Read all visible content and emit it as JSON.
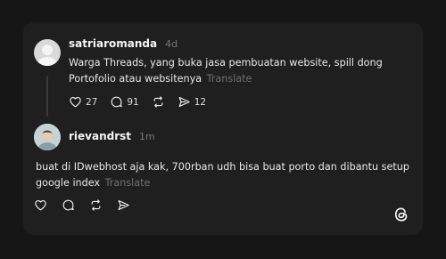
{
  "posts": [
    {
      "username": "satriaromanda",
      "time": "4d",
      "text": "Warga Threads, yang buka jasa pembuatan website, spill dong Portofolio atau websitenya",
      "translate": "Translate",
      "likes": "27",
      "replies": "91",
      "shares": "12"
    },
    {
      "username": "rievandrst",
      "time": "1m",
      "text": "buat di IDwebhost aja kak, 700rban udh bisa buat porto dan dibantu setup google index",
      "translate": "Translate"
    }
  ],
  "icons": {
    "like": "heart-icon",
    "reply": "comment-icon",
    "repost": "repost-icon",
    "share": "send-icon",
    "logo": "threads-logo-icon"
  },
  "colors": {
    "background": "#161616",
    "card": "#1f1f1f",
    "text": "#f3f5f7",
    "muted": "#777777"
  }
}
